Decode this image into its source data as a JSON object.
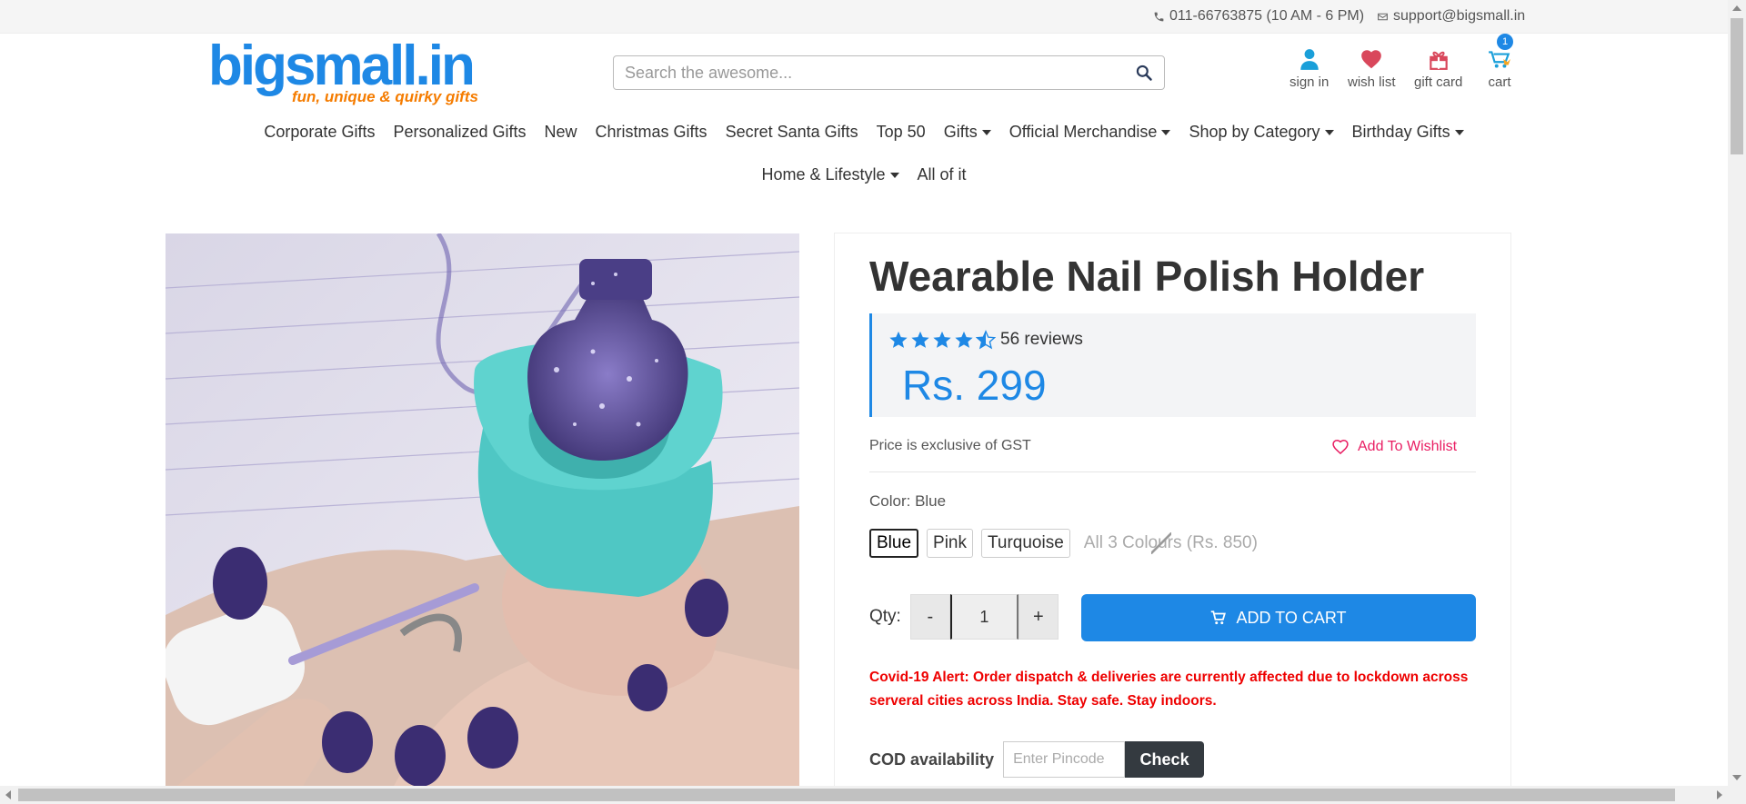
{
  "topbar": {
    "phone": "011-66763875 (10 AM - 6 PM)",
    "email": "support@bigsmall.in"
  },
  "logo": {
    "name": "bigsmall.in",
    "tagline": "fun, unique & quirky gifts"
  },
  "search": {
    "placeholder": "Search the awesome..."
  },
  "header_icons": {
    "sign_in": "sign in",
    "wish_list": "wish list",
    "gift_card": "gift card",
    "cart": "cart",
    "cart_count": "1"
  },
  "nav": {
    "row1": [
      {
        "label": "Corporate Gifts",
        "dropdown": false
      },
      {
        "label": "Personalized Gifts",
        "dropdown": false
      },
      {
        "label": "New",
        "dropdown": false
      },
      {
        "label": "Christmas Gifts",
        "dropdown": false
      },
      {
        "label": "Secret Santa Gifts",
        "dropdown": false
      },
      {
        "label": "Top 50",
        "dropdown": false
      },
      {
        "label": "Gifts",
        "dropdown": true
      },
      {
        "label": "Official Merchandise",
        "dropdown": true
      },
      {
        "label": "Shop by Category",
        "dropdown": true
      },
      {
        "label": "Birthday Gifts",
        "dropdown": true
      }
    ],
    "row2": [
      {
        "label": "Home & Lifestyle",
        "dropdown": true
      },
      {
        "label": "All of it",
        "dropdown": false
      }
    ]
  },
  "product": {
    "title": "Wearable Nail Polish Holder",
    "rating": 4.5,
    "reviews": "56 reviews",
    "price": "Rs. 299",
    "gst_note": "Price is exclusive of GST",
    "wishlist_label": "Add To Wishlist",
    "color_label": "Color: Blue",
    "colors": [
      {
        "label": "Blue",
        "selected": true,
        "available": true
      },
      {
        "label": "Pink",
        "selected": false,
        "available": true
      },
      {
        "label": "Turquoise",
        "selected": false,
        "available": true
      },
      {
        "label": "All 3 Colours (Rs. 850)",
        "selected": false,
        "available": false
      }
    ],
    "qty_label": "Qty:",
    "qty_minus": "-",
    "qty_value": "1",
    "qty_plus": "+",
    "add_to_cart": "ADD TO CART",
    "alert": "Covid-19 Alert: Order dispatch & deliveries are currently affected due to lockdown across serveral cities across India. Stay safe. Stay indoors.",
    "cod_label": "COD availability",
    "pincode_placeholder": "Enter Pincode",
    "check_label": "Check"
  },
  "colors": {
    "brand_blue": "#1e88e5",
    "brand_orange": "#f57c00",
    "wishlist_pink": "#e91e63",
    "alert_red": "#ee0000"
  }
}
